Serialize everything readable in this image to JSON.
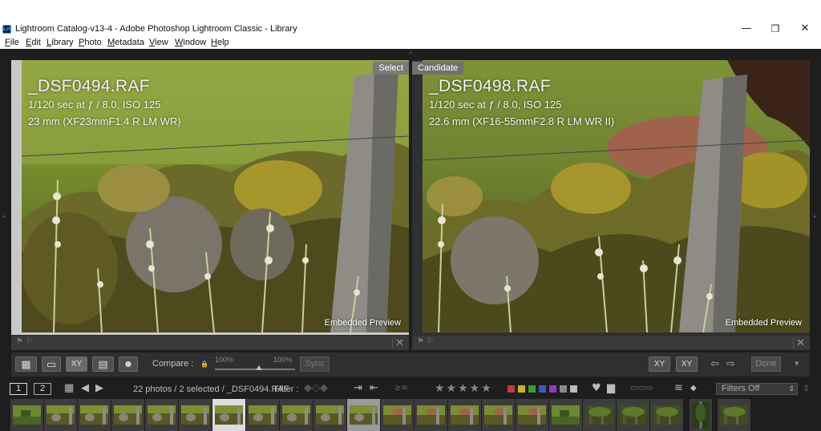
{
  "window": {
    "title": "Lightroom Catalog-v13-4 - Adobe Photoshop Lightroom Classic - Library",
    "app_icon": "LrC",
    "minimize": "—",
    "restore": "❐",
    "close": "✕"
  },
  "menu": [
    "File",
    "Edit",
    "Library",
    "Photo",
    "Metadata",
    "View",
    "Window",
    "Help"
  ],
  "select_panel": {
    "tag": "Select",
    "filename": "_DSF0494.RAF",
    "exposure": "1/120 sec at ƒ / 8.0, ISO 125",
    "lens": "23 mm (XF23mmF1.4 R LM WR)",
    "preview": "Embedded Preview"
  },
  "candidate_panel": {
    "tag": "Candidate",
    "filename": "_DSF0498.RAF",
    "exposure": "1/120 sec at ƒ / 8.0, ISO 125",
    "lens": "22.6 mm (XF16-55mmF2.8 R LM WR II)",
    "preview": "Embedded Preview"
  },
  "toolbar": {
    "grid_icon": "▦",
    "loupe_icon": "▭",
    "compare_label": "XY",
    "survey_icon": "▤",
    "people_icon": "☻",
    "compare_text": "Compare :",
    "lock_icon": "🔒",
    "zoom_left": "100%",
    "zoom_right": "100%",
    "sync": "Sync",
    "swap_label": "XY",
    "make_select_label": "XY",
    "prev_arrow": "⇦",
    "next_arrow": "⇨",
    "done": "Done",
    "menu_arrow": "▾",
    "zoom_level": 0.55
  },
  "filmstrip_header": {
    "view1": "1",
    "view2": "2",
    "status": "22 photos / 2 selected / _DSF0494.RAF",
    "filter_label": "Filter :",
    "stars": "★★★★★",
    "filters_off": "Filters Off",
    "swatch_colors": [
      "#c33a3a",
      "#c9b22c",
      "#3a9a3a",
      "#3a5ac8",
      "#8a3ac8",
      "#888888",
      "#bbbbbb"
    ]
  },
  "thumbnails": [
    {
      "kind": "grass"
    },
    {
      "kind": "wall"
    },
    {
      "kind": "wall"
    },
    {
      "kind": "wall"
    },
    {
      "kind": "wall"
    },
    {
      "kind": "wall"
    },
    {
      "kind": "wall",
      "primary": true
    },
    {
      "kind": "wall"
    },
    {
      "kind": "wall"
    },
    {
      "kind": "wall"
    },
    {
      "kind": "wall",
      "selected": true
    },
    {
      "kind": "horse"
    },
    {
      "kind": "horse"
    },
    {
      "kind": "horse"
    },
    {
      "kind": "horse"
    },
    {
      "kind": "horse"
    },
    {
      "kind": "grass"
    },
    {
      "kind": "forest"
    },
    {
      "kind": "forest"
    },
    {
      "kind": "forest"
    },
    {
      "kind": "tree"
    },
    {
      "kind": "forest"
    }
  ]
}
